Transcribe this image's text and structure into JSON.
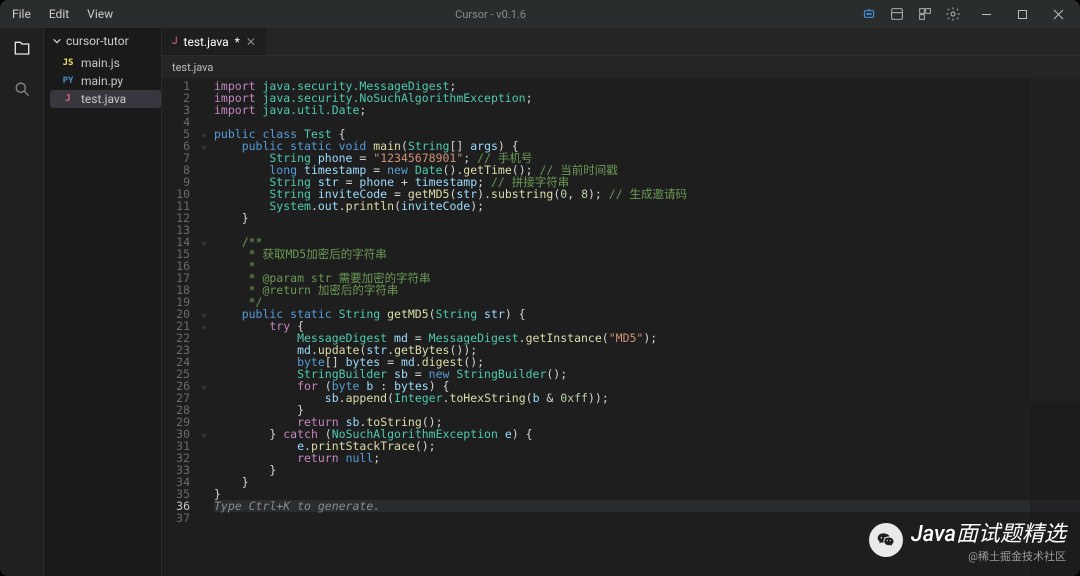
{
  "titlebar": {
    "menus": [
      "File",
      "Edit",
      "View"
    ],
    "title": "Cursor - v0.1.6"
  },
  "sidebar": {
    "root": "cursor-tutor",
    "files": [
      {
        "icon": "JS",
        "name": "main.js",
        "cls": "js"
      },
      {
        "icon": "PY",
        "name": "main.py",
        "cls": "py"
      },
      {
        "icon": "J",
        "name": "test.java",
        "cls": "java",
        "selected": true
      }
    ]
  },
  "tabs": {
    "active": {
      "icon": "J",
      "label": "test.java",
      "dirty": true
    }
  },
  "crumbs": "test.java",
  "watermark": {
    "top": "Java面试题精选",
    "bottom": "@稀土掘金技术社区"
  },
  "code": {
    "placeholder": "Type Ctrl+K to generate.",
    "lines": [
      [
        {
          "t": "import ",
          "c": "kw2"
        },
        {
          "t": "java.security.MessageDigest",
          "c": "ty"
        },
        {
          "t": ";",
          "c": ""
        }
      ],
      [
        {
          "t": "import ",
          "c": "kw2"
        },
        {
          "t": "java.security.NoSuchAlgorithmException",
          "c": "ty"
        },
        {
          "t": ";",
          "c": ""
        }
      ],
      [
        {
          "t": "import ",
          "c": "kw2"
        },
        {
          "t": "java.util.Date",
          "c": "ty"
        },
        {
          "t": ";",
          "c": ""
        }
      ],
      [],
      [
        {
          "t": "public class ",
          "c": "kw"
        },
        {
          "t": "Test",
          "c": "ty"
        },
        {
          "t": " {",
          "c": ""
        }
      ],
      [
        {
          "t": "    public static void ",
          "c": "kw"
        },
        {
          "t": "main",
          "c": "fn"
        },
        {
          "t": "(",
          "c": ""
        },
        {
          "t": "String",
          "c": "ty"
        },
        {
          "t": "[] ",
          "c": ""
        },
        {
          "t": "args",
          "c": "id"
        },
        {
          "t": ") {",
          "c": ""
        }
      ],
      [
        {
          "t": "        String ",
          "c": "ty"
        },
        {
          "t": "phone",
          "c": "id"
        },
        {
          "t": " = ",
          "c": ""
        },
        {
          "t": "\"12345678901\"",
          "c": "st"
        },
        {
          "t": "; ",
          "c": ""
        },
        {
          "t": "// 手机号",
          "c": "cm"
        }
      ],
      [
        {
          "t": "        long ",
          "c": "kw"
        },
        {
          "t": "timestamp",
          "c": "id"
        },
        {
          "t": " = ",
          "c": ""
        },
        {
          "t": "new ",
          "c": "kw"
        },
        {
          "t": "Date",
          "c": "ty"
        },
        {
          "t": "().",
          "c": ""
        },
        {
          "t": "getTime",
          "c": "fn"
        },
        {
          "t": "(); ",
          "c": ""
        },
        {
          "t": "// 当前时间戳",
          "c": "cm"
        }
      ],
      [
        {
          "t": "        String ",
          "c": "ty"
        },
        {
          "t": "str",
          "c": "id"
        },
        {
          "t": " = ",
          "c": ""
        },
        {
          "t": "phone",
          "c": "id"
        },
        {
          "t": " + ",
          "c": ""
        },
        {
          "t": "timestamp",
          "c": "id"
        },
        {
          "t": "; ",
          "c": ""
        },
        {
          "t": "// 拼接字符串",
          "c": "cm"
        }
      ],
      [
        {
          "t": "        String ",
          "c": "ty"
        },
        {
          "t": "inviteCode",
          "c": "id"
        },
        {
          "t": " = ",
          "c": ""
        },
        {
          "t": "getMD5",
          "c": "fn"
        },
        {
          "t": "(",
          "c": ""
        },
        {
          "t": "str",
          "c": "id"
        },
        {
          "t": ").",
          "c": ""
        },
        {
          "t": "substring",
          "c": "fn"
        },
        {
          "t": "(",
          "c": ""
        },
        {
          "t": "0",
          "c": "nm"
        },
        {
          "t": ", ",
          "c": ""
        },
        {
          "t": "8",
          "c": "nm"
        },
        {
          "t": "); ",
          "c": ""
        },
        {
          "t": "// 生成邀请码",
          "c": "cm"
        }
      ],
      [
        {
          "t": "        System",
          "c": "ty"
        },
        {
          "t": ".",
          "c": ""
        },
        {
          "t": "out",
          "c": "id"
        },
        {
          "t": ".",
          "c": ""
        },
        {
          "t": "println",
          "c": "fn"
        },
        {
          "t": "(",
          "c": ""
        },
        {
          "t": "inviteCode",
          "c": "id"
        },
        {
          "t": ");",
          "c": ""
        }
      ],
      [
        {
          "t": "    }",
          "c": ""
        }
      ],
      [],
      [
        {
          "t": "    /**",
          "c": "cm"
        }
      ],
      [
        {
          "t": "     * 获取MD5加密后的字符串",
          "c": "cm"
        }
      ],
      [
        {
          "t": "     *",
          "c": "cm"
        }
      ],
      [
        {
          "t": "     * @param str 需要加密的字符串",
          "c": "cm"
        }
      ],
      [
        {
          "t": "     * @return 加密后的字符串",
          "c": "cm"
        }
      ],
      [
        {
          "t": "     */",
          "c": "cm"
        }
      ],
      [
        {
          "t": "    public static ",
          "c": "kw"
        },
        {
          "t": "String ",
          "c": "ty"
        },
        {
          "t": "getMD5",
          "c": "fn"
        },
        {
          "t": "(",
          "c": ""
        },
        {
          "t": "String ",
          "c": "ty"
        },
        {
          "t": "str",
          "c": "id"
        },
        {
          "t": ") {",
          "c": ""
        }
      ],
      [
        {
          "t": "        try ",
          "c": "kw2"
        },
        {
          "t": "{",
          "c": ""
        }
      ],
      [
        {
          "t": "            MessageDigest ",
          "c": "ty"
        },
        {
          "t": "md",
          "c": "id"
        },
        {
          "t": " = ",
          "c": ""
        },
        {
          "t": "MessageDigest",
          "c": "ty"
        },
        {
          "t": ".",
          "c": ""
        },
        {
          "t": "getInstance",
          "c": "fn"
        },
        {
          "t": "(",
          "c": ""
        },
        {
          "t": "\"MD5\"",
          "c": "st"
        },
        {
          "t": ");",
          "c": ""
        }
      ],
      [
        {
          "t": "            md",
          "c": "id"
        },
        {
          "t": ".",
          "c": ""
        },
        {
          "t": "update",
          "c": "fn"
        },
        {
          "t": "(",
          "c": ""
        },
        {
          "t": "str",
          "c": "id"
        },
        {
          "t": ".",
          "c": ""
        },
        {
          "t": "getBytes",
          "c": "fn"
        },
        {
          "t": "());",
          "c": ""
        }
      ],
      [
        {
          "t": "            byte",
          "c": "kw"
        },
        {
          "t": "[] ",
          "c": ""
        },
        {
          "t": "bytes",
          "c": "id"
        },
        {
          "t": " = ",
          "c": ""
        },
        {
          "t": "md",
          "c": "id"
        },
        {
          "t": ".",
          "c": ""
        },
        {
          "t": "digest",
          "c": "fn"
        },
        {
          "t": "();",
          "c": ""
        }
      ],
      [
        {
          "t": "            StringBuilder ",
          "c": "ty"
        },
        {
          "t": "sb",
          "c": "id"
        },
        {
          "t": " = ",
          "c": ""
        },
        {
          "t": "new ",
          "c": "kw"
        },
        {
          "t": "StringBuilder",
          "c": "ty"
        },
        {
          "t": "();",
          "c": ""
        }
      ],
      [
        {
          "t": "            for ",
          "c": "kw2"
        },
        {
          "t": "(",
          "c": ""
        },
        {
          "t": "byte ",
          "c": "kw"
        },
        {
          "t": "b",
          "c": "id"
        },
        {
          "t": " : ",
          "c": ""
        },
        {
          "t": "bytes",
          "c": "id"
        },
        {
          "t": ") {",
          "c": ""
        }
      ],
      [
        {
          "t": "                sb",
          "c": "id"
        },
        {
          "t": ".",
          "c": ""
        },
        {
          "t": "append",
          "c": "fn"
        },
        {
          "t": "(",
          "c": ""
        },
        {
          "t": "Integer",
          "c": "ty"
        },
        {
          "t": ".",
          "c": ""
        },
        {
          "t": "toHexString",
          "c": "fn"
        },
        {
          "t": "(",
          "c": ""
        },
        {
          "t": "b",
          "c": "id"
        },
        {
          "t": " & ",
          "c": ""
        },
        {
          "t": "0xff",
          "c": "nm"
        },
        {
          "t": "));",
          "c": ""
        }
      ],
      [
        {
          "t": "            }",
          "c": ""
        }
      ],
      [
        {
          "t": "            return ",
          "c": "kw2"
        },
        {
          "t": "sb",
          "c": "id"
        },
        {
          "t": ".",
          "c": ""
        },
        {
          "t": "toString",
          "c": "fn"
        },
        {
          "t": "();",
          "c": ""
        }
      ],
      [
        {
          "t": "        } ",
          "c": ""
        },
        {
          "t": "catch ",
          "c": "kw2"
        },
        {
          "t": "(",
          "c": ""
        },
        {
          "t": "NoSuchAlgorithmException ",
          "c": "ty"
        },
        {
          "t": "e",
          "c": "id"
        },
        {
          "t": ") {",
          "c": ""
        }
      ],
      [
        {
          "t": "            e",
          "c": "id"
        },
        {
          "t": ".",
          "c": ""
        },
        {
          "t": "printStackTrace",
          "c": "fn"
        },
        {
          "t": "();",
          "c": ""
        }
      ],
      [
        {
          "t": "            return ",
          "c": "kw2"
        },
        {
          "t": "null",
          "c": "kw"
        },
        {
          "t": ";",
          "c": ""
        }
      ],
      [
        {
          "t": "        }",
          "c": ""
        }
      ],
      [
        {
          "t": "    }",
          "c": ""
        }
      ],
      [
        {
          "t": "}",
          "c": ""
        }
      ],
      [],
      []
    ],
    "current_line": 36,
    "fold_lines": [
      5,
      6,
      14,
      20,
      21,
      26,
      30
    ]
  }
}
